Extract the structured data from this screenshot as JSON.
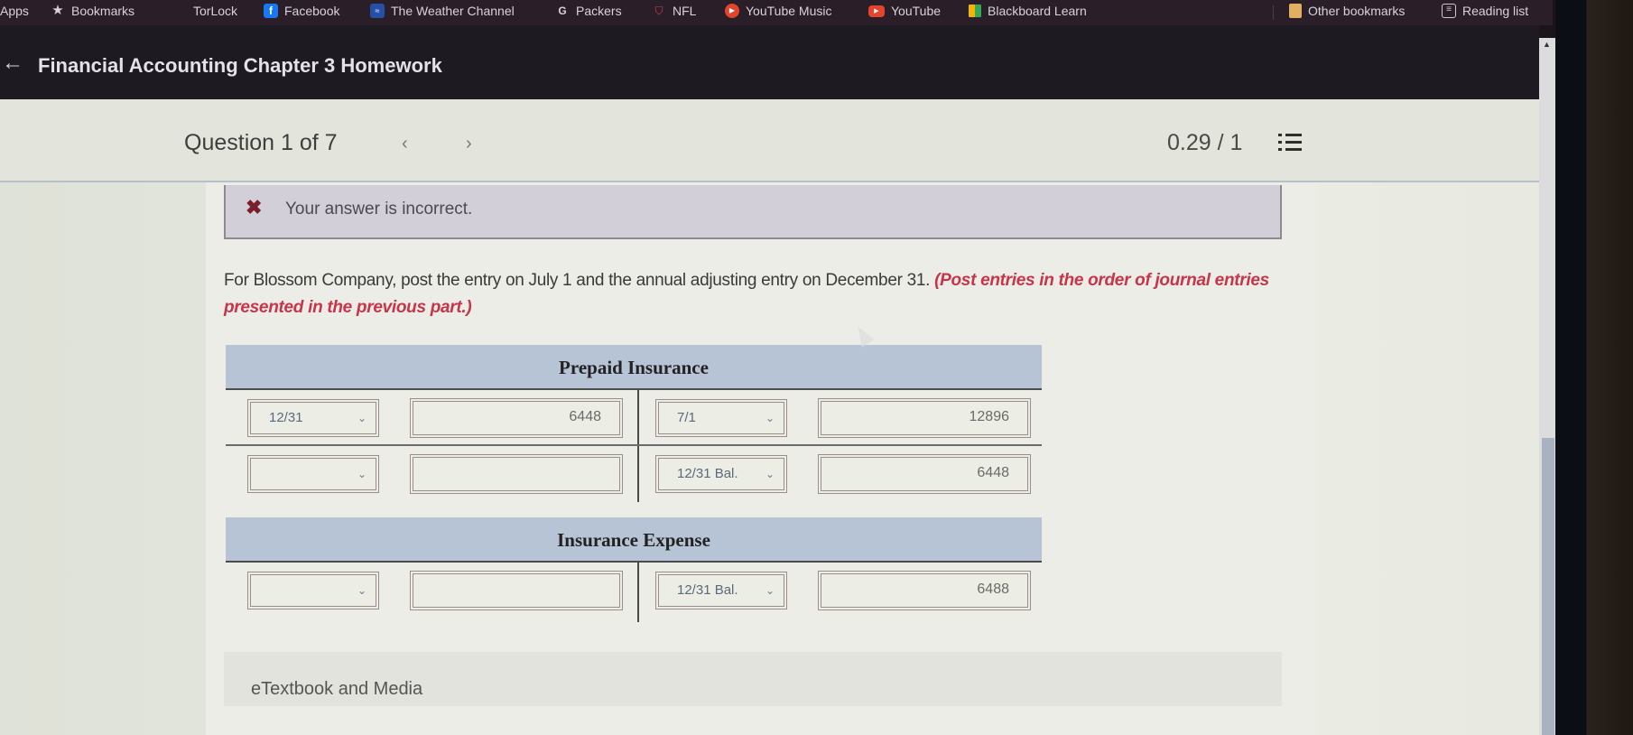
{
  "bookmarks_bar": {
    "items": [
      {
        "label": "Apps",
        "icon": "apps-icon"
      },
      {
        "label": "Bookmarks",
        "icon": "star-icon"
      },
      {
        "label": "TorLock",
        "icon": ""
      },
      {
        "label": "Facebook",
        "icon": "facebook-icon"
      },
      {
        "label": "The Weather Channel",
        "icon": "weather-channel-icon"
      },
      {
        "label": "Packers",
        "icon": "google-icon"
      },
      {
        "label": "NFL",
        "icon": "nfl-icon"
      },
      {
        "label": "YouTube Music",
        "icon": "youtube-music-icon"
      },
      {
        "label": "YouTube",
        "icon": "youtube-icon"
      },
      {
        "label": "Blackboard Learn",
        "icon": "blackboard-icon"
      }
    ],
    "other_bookmarks": "Other bookmarks",
    "reading_list": "Reading list"
  },
  "header": {
    "back_icon": "←",
    "title": "Financial Accounting Chapter 3 Homework"
  },
  "question_nav": {
    "label": "Question 1 of 7",
    "prev_icon": "‹",
    "next_icon": "›",
    "score": "0.29 / 1"
  },
  "alert": {
    "icon": "✖",
    "text": "Your answer is incorrect."
  },
  "instructions": {
    "main": "For Blossom Company, post the entry on July 1 and the annual adjusting entry on December 31. ",
    "note": "(Post entries in the order of journal entries presented in the previous part.)"
  },
  "accounts": [
    {
      "title": "Prepaid Insurance",
      "rows": [
        {
          "left_date": "12/31",
          "left_amount": "6448",
          "right_date": "7/1",
          "right_amount": "12896"
        },
        {
          "left_date": "",
          "left_amount": "",
          "right_date": "12/31 Bal.",
          "right_amount": "6448"
        }
      ]
    },
    {
      "title": "Insurance Expense",
      "rows": [
        {
          "left_date": "",
          "left_amount": "",
          "right_date": "12/31 Bal.",
          "right_amount": "6488"
        }
      ]
    }
  ],
  "etextbook": {
    "label": "eTextbook and Media"
  },
  "chevron": "⌄"
}
